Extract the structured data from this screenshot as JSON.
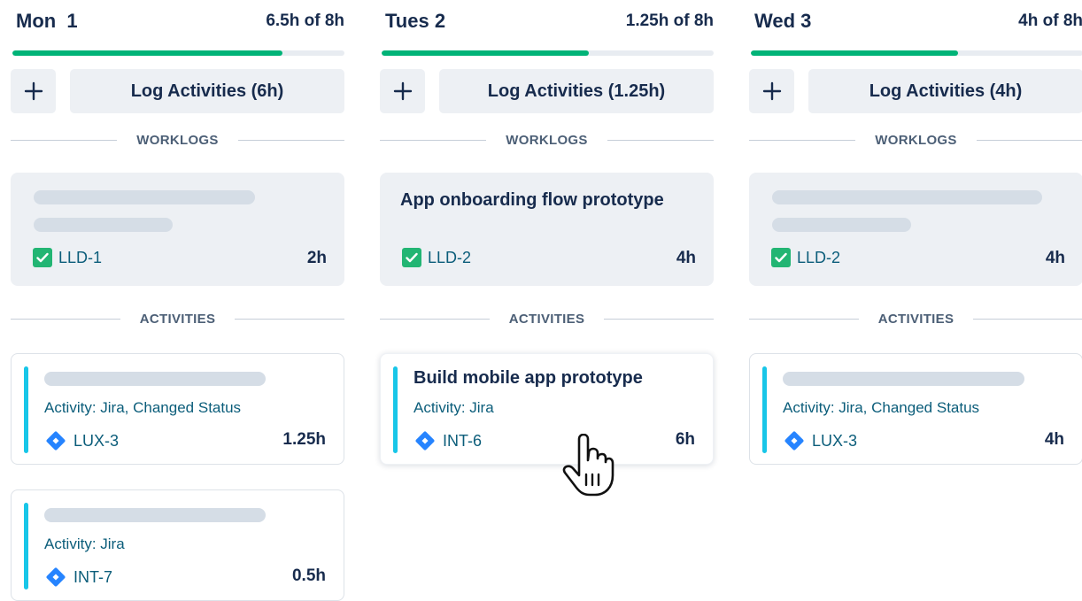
{
  "days": [
    {
      "title": "Mon  1",
      "hours": "6.5h of 8h",
      "progress": 0.8125,
      "log_label": "Log Activities (6h)",
      "worklogs_label": "WORKLOGS",
      "activities_label": "ACTIVITIES",
      "worklog": {
        "title": "",
        "key": "LLD-1",
        "hours": "2h"
      },
      "activities": [
        {
          "title": "",
          "subtitle": "Activity: Jira, Changed Status",
          "key": "LUX-3",
          "hours": "1.25h"
        },
        {
          "title": "",
          "subtitle": "Activity: Jira",
          "key": "INT-7",
          "hours": "0.5h"
        }
      ]
    },
    {
      "title": "Tues 2",
      "hours": "1.25h of 8h",
      "progress": 0.625,
      "log_label": "Log Activities (1.25h)",
      "worklogs_label": "WORKLOGS",
      "activities_label": "ACTIVITIES",
      "worklog": {
        "title": "App onboarding flow prototype",
        "key": "LLD-2",
        "hours": "4h"
      },
      "activities": [
        {
          "title": "Build mobile app prototype",
          "subtitle": "Activity: Jira",
          "key": "INT-6",
          "hours": "6h"
        }
      ]
    },
    {
      "title": "Wed 3",
      "hours": "4h of 8h",
      "progress": 0.625,
      "log_label": "Log Activities (4h)",
      "worklogs_label": "WORKLOGS",
      "activities_label": "ACTIVITIES",
      "worklog": {
        "title": "",
        "key": "LLD-2",
        "hours": "4h"
      },
      "activities": [
        {
          "title": "",
          "subtitle": "Activity: Jira, Changed Status",
          "key": "LUX-3",
          "hours": "4h"
        }
      ]
    }
  ],
  "colors": {
    "progress": "#00b377",
    "activity_bar": "#18c6e8",
    "check": "#22b573",
    "jira": "#2684ff"
  },
  "icons": {
    "add": "plus-icon",
    "worklog_key": "check-square-icon",
    "activity_key": "jira-diamond-icon",
    "pointer": "hand-pointer-cursor"
  }
}
